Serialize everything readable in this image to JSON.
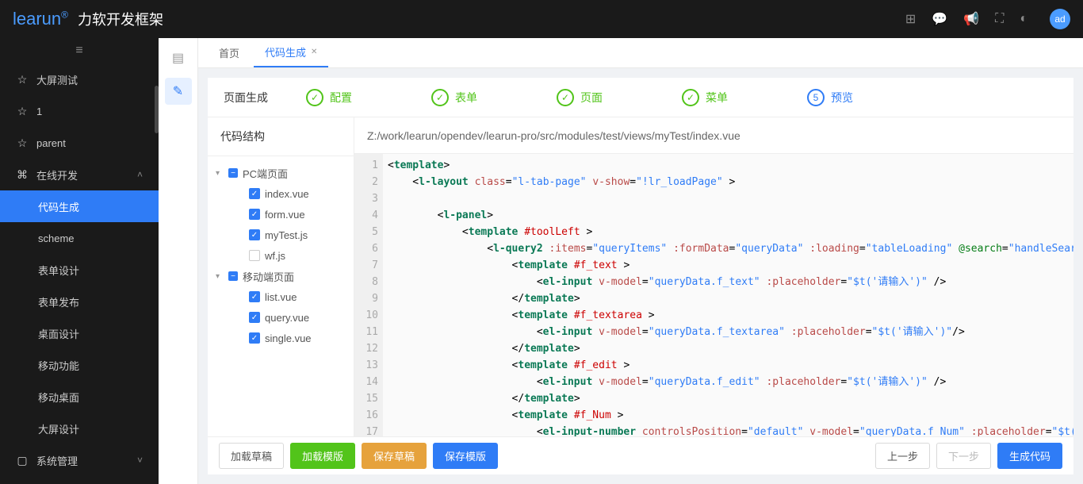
{
  "header": {
    "logo": "learun",
    "logo_sup": "®",
    "title": "力软开发框架",
    "avatar": "ad"
  },
  "sidebar": {
    "items": [
      {
        "icon": "☆",
        "label": "大屏测试"
      },
      {
        "icon": "☆",
        "label": "1"
      },
      {
        "icon": "☆",
        "label": "parent"
      },
      {
        "icon": "⌘",
        "label": "在线开发",
        "expanded": true
      },
      {
        "label": "代码生成",
        "child": true,
        "active": true
      },
      {
        "label": "scheme",
        "child": true
      },
      {
        "label": "表单设计",
        "child": true
      },
      {
        "label": "表单发布",
        "child": true
      },
      {
        "label": "桌面设计",
        "child": true
      },
      {
        "label": "移动功能",
        "child": true
      },
      {
        "label": "移动桌面",
        "child": true
      },
      {
        "label": "大屏设计",
        "child": true
      },
      {
        "icon": "▢",
        "label": "系统管理",
        "hasChevron": true
      }
    ]
  },
  "tabs": [
    {
      "label": "首页"
    },
    {
      "label": "代码生成",
      "active": true,
      "closable": true
    }
  ],
  "steps": {
    "title": "页面生成",
    "items": [
      {
        "label": "配置",
        "done": true
      },
      {
        "label": "表单",
        "done": true
      },
      {
        "label": "页面",
        "done": true
      },
      {
        "label": "菜单",
        "done": true
      },
      {
        "label": "预览",
        "num": "5",
        "current": true
      }
    ]
  },
  "tree": {
    "title": "代码结构",
    "nodes": [
      {
        "label": "PC端页面",
        "type": "folder",
        "expanded": true
      },
      {
        "label": "index.vue",
        "type": "file",
        "checked": true
      },
      {
        "label": "form.vue",
        "type": "file",
        "checked": true
      },
      {
        "label": "myTest.js",
        "type": "file",
        "checked": true
      },
      {
        "label": "wf.js",
        "type": "file",
        "checked": false
      },
      {
        "label": "移动端页面",
        "type": "folder",
        "expanded": true
      },
      {
        "label": "list.vue",
        "type": "file",
        "checked": true
      },
      {
        "label": "query.vue",
        "type": "file",
        "checked": true
      },
      {
        "label": "single.vue",
        "type": "file",
        "checked": true
      }
    ]
  },
  "codePath": "Z:/work/learun/opendev/learun-pro/src/modules/test/views/myTest/index.vue",
  "footer": {
    "loadDraft": "加载草稿",
    "loadTemplate": "加载模版",
    "saveDraft": "保存草稿",
    "saveTemplate": "保存模版",
    "prev": "上一步",
    "next": "下一步",
    "generate": "生成代码"
  }
}
